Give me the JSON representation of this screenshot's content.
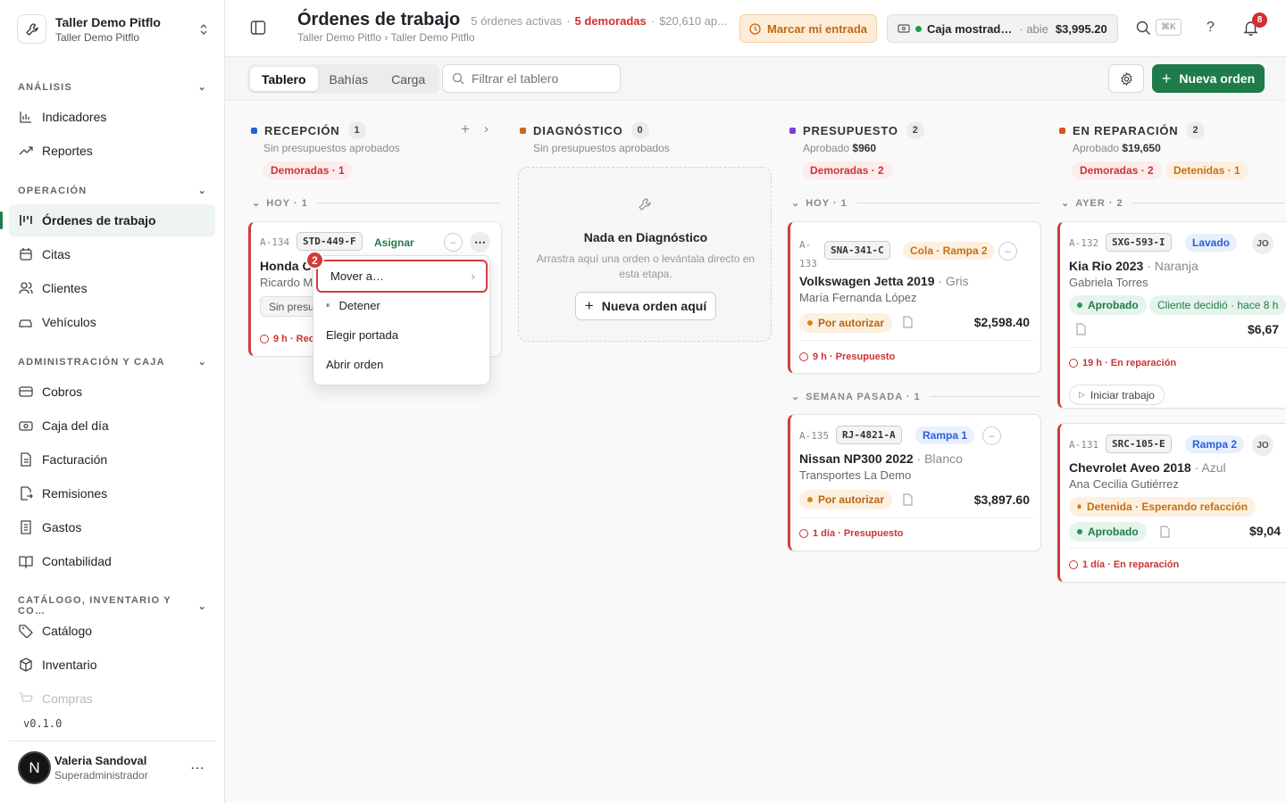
{
  "workspace": {
    "name": "Taller Demo Pitflo",
    "sub": "Taller Demo Pitflo"
  },
  "sidebar": {
    "sections": [
      {
        "title": "ANÁLISIS",
        "items": [
          {
            "label": "Indicadores",
            "icon": "bar-chart-icon"
          },
          {
            "label": "Reportes",
            "icon": "trend-icon"
          }
        ]
      },
      {
        "title": "OPERACIÓN",
        "items": [
          {
            "label": "Órdenes de trabajo",
            "icon": "kanban-icon",
            "active": true
          },
          {
            "label": "Citas",
            "icon": "calendar-icon"
          },
          {
            "label": "Clientes",
            "icon": "users-icon"
          },
          {
            "label": "Vehículos",
            "icon": "car-icon"
          }
        ]
      },
      {
        "title": "ADMINISTRACIÓN Y CAJA",
        "items": [
          {
            "label": "Cobros",
            "icon": "card-icon"
          },
          {
            "label": "Caja del día",
            "icon": "cash-icon"
          },
          {
            "label": "Facturación",
            "icon": "file-icon"
          },
          {
            "label": "Remisiones",
            "icon": "export-icon"
          },
          {
            "label": "Gastos",
            "icon": "receipt-icon"
          },
          {
            "label": "Contabilidad",
            "icon": "book-icon"
          }
        ]
      },
      {
        "title": "CATÁLOGO, INVENTARIO Y CO…",
        "items": [
          {
            "label": "Catálogo",
            "icon": "tag-icon"
          },
          {
            "label": "Inventario",
            "icon": "box-icon"
          },
          {
            "label": "Compras",
            "icon": "cart-icon"
          }
        ]
      }
    ],
    "version": "v0.1.0",
    "user": {
      "initial": "N",
      "name": "Valeria Sandoval",
      "role": "Superadministrador"
    }
  },
  "header": {
    "title": "Órdenes de trabajo",
    "active": "5 órdenes activas",
    "sep": "·",
    "late": "5 demoradas",
    "amount": "$20,610 ap...",
    "breadcrumb": "Taller Demo Pitflo › Taller Demo Pitflo",
    "checkin": "Marcar mi entrada",
    "cash_name": "Caja mostrad…",
    "cash_state": "· abie",
    "cash_amount": "$3,995.20",
    "shortcut": "⌘K",
    "help": "?",
    "notif_count": "8"
  },
  "toolbar": {
    "tabs": [
      "Tablero",
      "Bahías",
      "Carga"
    ],
    "filter_placeholder": "Filtrar el tablero",
    "new_order": "Nueva orden"
  },
  "columns": [
    {
      "name": "RECEPCIÓN",
      "count": "1",
      "sub": "Sin presupuestos aprobados",
      "color": "#2b5fd9"
    },
    {
      "name": "DIAGNÓSTICO",
      "count": "0",
      "sub": "Sin presupuestos aprobados",
      "color": "#c9661c"
    },
    {
      "name": "PRESUPUESTO",
      "count": "2",
      "sub_prefix": "Aprobado",
      "sub_value": "$960",
      "color": "#7a3fd1"
    },
    {
      "name": "EN REPARACIÓN",
      "count": "2",
      "sub_prefix": "Aprobado",
      "sub_value": "$19,650",
      "color": "#d9541e"
    }
  ],
  "pills": {
    "rec": "Demoradas · 1",
    "pres": "Demoradas · 2",
    "rep_late": "Demoradas · 2",
    "rep_hold": "Detenidas · 1"
  },
  "groups": {
    "rec_today": "HOY · 1",
    "pres_today": "HOY · 1",
    "pres_week": "SEMANA PASADA · 1",
    "rep_yesterday": "AYER · 2"
  },
  "empty": {
    "title": "Nada en Diagnóstico",
    "text": "Arrastra aquí una orden o levántala directo en esta etapa.",
    "button": "Nueva orden aquí"
  },
  "cards": {
    "a134": {
      "code": "A-134",
      "plate": "STD-449-F",
      "assign": "Asignar",
      "vehicle": "Honda C",
      "owner": "Ricardo M",
      "budget": "Sin presu",
      "foot": "9 h · Rec"
    },
    "a133": {
      "code_a": "A-",
      "code_b": "133",
      "plate": "SNA-341-C",
      "tag": "Cola · Rampa 2",
      "vehicle": "Volkswagen Jetta 2019",
      "color": "· Gris",
      "owner": "María Fernanda López",
      "status": "Por autorizar",
      "amount": "$2,598.40",
      "foot": "9 h · Presupuesto"
    },
    "a135": {
      "code": "A-135",
      "plate": "RJ-4821-A",
      "tag": "Rampa 1",
      "vehicle": "Nissan NP300 2022",
      "color": "· Blanco",
      "owner": "Transportes La Demo",
      "status": "Por autorizar",
      "amount": "$3,897.60",
      "foot": "1 día · Presupuesto"
    },
    "a132": {
      "code": "A-132",
      "plate": "SXG-593-I",
      "tag": "Lavado",
      "initials": "JO",
      "vehicle": "Kia Rio 2023",
      "color": "· Naranja",
      "owner": "Gabriela Torres",
      "status": "Aprobado",
      "decided": "Cliente decidió · hace 8 h",
      "amount": "$6,67",
      "foot": "19 h · En reparación",
      "start": "Iniciar trabajo"
    },
    "a131": {
      "code": "A-131",
      "plate": "SRC-105-E",
      "tag": "Rampa 2",
      "initials": "JO",
      "vehicle": "Chevrolet Aveo 2018",
      "color": "· Azul",
      "owner": "Ana Cecilia Gutiérrez",
      "hold": "Detenida · Esperando refacción",
      "status": "Aprobado",
      "amount": "$9,04",
      "foot": "1 día · En reparación"
    }
  },
  "menu": {
    "badge": "2",
    "items": [
      "Mover a…",
      "Detener",
      "Elegir portada",
      "Abrir orden"
    ]
  }
}
